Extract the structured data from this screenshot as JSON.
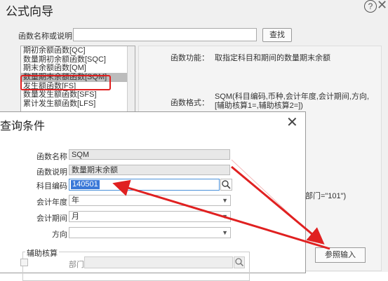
{
  "wizard": {
    "title": "公式向导",
    "help_icon": "?",
    "close_icon": "✕",
    "search_label": "函数名称或说明:",
    "search_value": "",
    "search_button": "查找",
    "function_list": [
      "期初余额函数[QC]",
      "数量期初余额函数[SQC]",
      "期末余额函数[QM]",
      "数量期末余额函数[SQM]",
      "发生额函数[FS]",
      "数量发生额函数[SFS]",
      "累计发生额函数[LFS]"
    ],
    "selected_index": 3,
    "function_label": "函数功能：",
    "function_value": "取指定科目和期间的数量期末余额",
    "format_label": "函数格式：",
    "format_value": "SQM(科目编码,币种,会计年度,会计期间,方向,[辅助核算1=,辅助核算2=])",
    "example_text": "\",部门=\"101\")",
    "reference_button": "参照输入"
  },
  "dialog": {
    "title": "查询条件",
    "close_icon": "✕",
    "func_name_label": "函数名称",
    "func_name_value": "SQM",
    "func_desc_label": "函数说明",
    "func_desc_value": "数量期末余额",
    "subject_code_label": "科目编码",
    "subject_code_value": "140501",
    "fiscal_year_label": "会计年度",
    "fiscal_year_value": "年",
    "fiscal_period_label": "会计期间",
    "fiscal_period_value": "月",
    "direction_label": "方向",
    "direction_value": "",
    "aux_group_label": "辅助核算",
    "dept_label": "部门",
    "dept_value": ""
  },
  "colors": {
    "annotation_red": "#e02020",
    "selection_blue": "#3a78d8"
  }
}
